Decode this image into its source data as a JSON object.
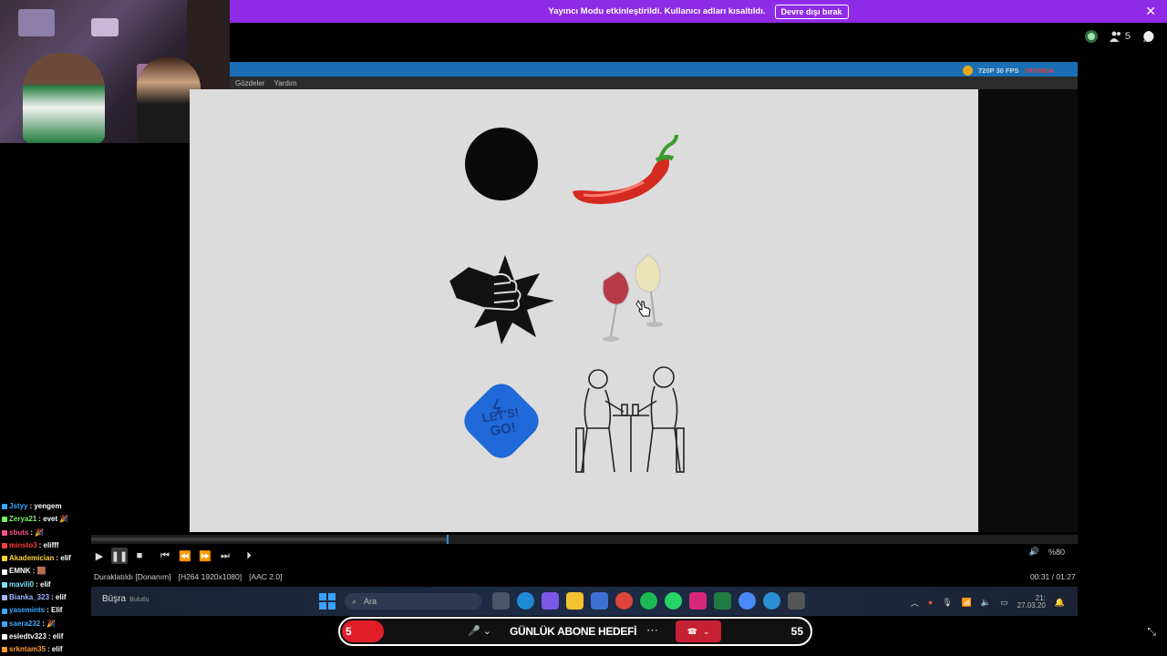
{
  "banner": {
    "message": "Yayıncı Modu etkinleştirildi. Kullanıcı adları kısaltıldı.",
    "disable_button": "Devre dışı bırak",
    "close_icon": "close-icon"
  },
  "top_right": {
    "member_count": "5"
  },
  "screen_share": {
    "quality": "720P 30 FPS",
    "live_label": "YAYINDA",
    "menu_items": [
      "Gözdeler",
      "Yardım"
    ]
  },
  "stage": {
    "background": "#dcdcdc",
    "icons": [
      "black-circle-icon",
      "chili-pepper-icon",
      "punch-fist-icon",
      "wine-glasses-icon",
      "lets-go-sticker-icon",
      "couple-at-table-icon"
    ],
    "sticker_text": "LET'S! GO!"
  },
  "player": {
    "progress": 0.36,
    "status": "Duraklatıldı [Donanım]",
    "video_codec": "[H264 1920x1080]",
    "audio_codec": "[AAC 2.0]",
    "time": "00:31 / 01:27",
    "volume": "%80"
  },
  "taskbar": {
    "user": "Büşra",
    "user_sub": "Bulutlu",
    "search_placeholder": "Ara",
    "clock_time": "21:",
    "clock_date": "27.03.20"
  },
  "chat": [
    {
      "name": "Jstyy",
      "text": ": yengem",
      "color": "#3aa8ff"
    },
    {
      "name": "Zerya21",
      "text": ": evet 🎉",
      "color": "#7cf26a"
    },
    {
      "name": "sbuts",
      "text": ": 🎉",
      "color": "#ff4f8a"
    },
    {
      "name": "minsto3",
      "text": ": elifff",
      "color": "#ff3b3b"
    },
    {
      "name": "Akademician",
      "text": ": elif",
      "color": "#ffd23a"
    },
    {
      "name": "EMNK",
      "text": ": 🟫",
      "color": "#ffffff"
    },
    {
      "name": "mavili0",
      "text": ": elif",
      "color": "#7ee3ff"
    },
    {
      "name": "Bianka_323",
      "text": ": elif",
      "color": "#9fb7ff"
    },
    {
      "name": "yasemints",
      "text": ": Elif",
      "color": "#3aa8ff"
    },
    {
      "name": "saera232",
      "text": ": 🎉",
      "color": "#3aa8ff"
    },
    {
      "name": "esledtv323",
      "text": ": elif",
      "color": "#ffffff"
    },
    {
      "name": "srkntam35",
      "text": ": elif",
      "color": "#ff9a3a"
    }
  ],
  "goal": {
    "current": "5",
    "target": "55",
    "title": "GÜNLÜK ABONE HEDEFİ",
    "progress": 0.09
  }
}
